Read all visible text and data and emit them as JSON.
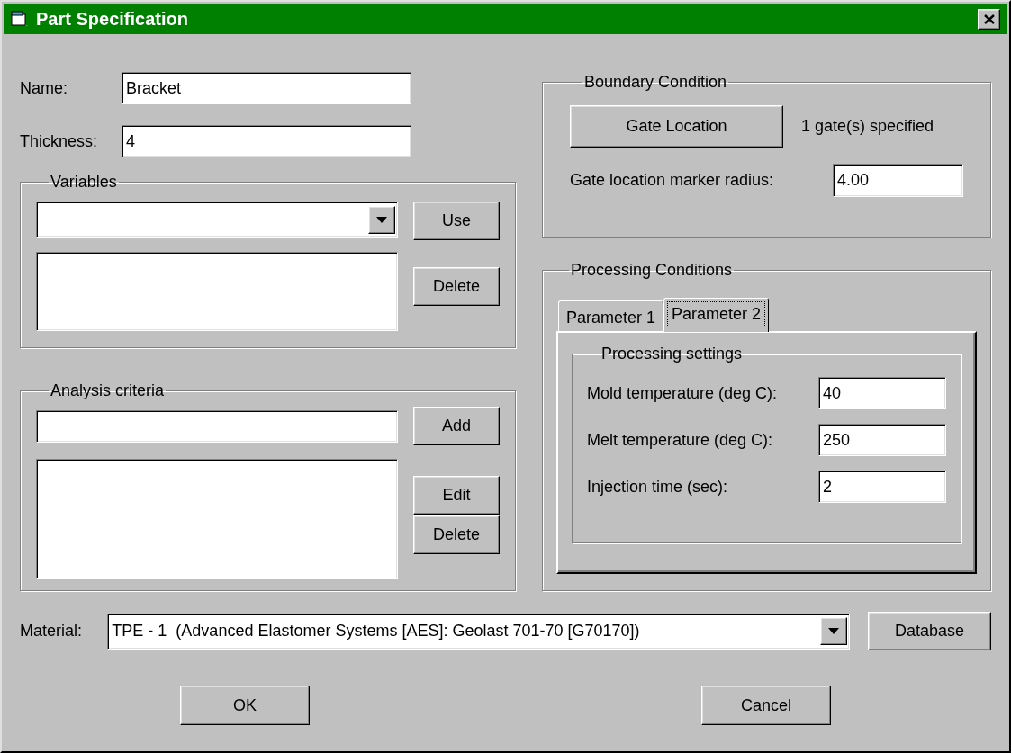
{
  "window": {
    "title": "Part Specification"
  },
  "name": {
    "label": "Name:",
    "value": "Bracket"
  },
  "thickness": {
    "label": "Thickness:",
    "value": "4"
  },
  "variables": {
    "title": "Variables",
    "buttons": [
      "Use",
      "Delete"
    ]
  },
  "analysis_criteria": {
    "title": "Analysis criteria",
    "buttons": [
      "Add",
      "Edit",
      "Delete"
    ]
  },
  "boundary_condition": {
    "title": "Boundary Condition",
    "gate_button": "Gate Location",
    "gate_status": "1 gate(s) specified",
    "radius_label": "Gate location marker radius:",
    "radius_value": "4.00"
  },
  "processing_conditions": {
    "title": "Processing Conditions",
    "tabs": [
      {
        "label": "Parameter 1",
        "selected": false
      },
      {
        "label": "Parameter 2",
        "selected": true
      }
    ],
    "group_title": "Processing settings",
    "fields": [
      {
        "label": "Mold temperature (deg C):",
        "value": "40"
      },
      {
        "label": "Melt temperature (deg C):",
        "value": "250"
      },
      {
        "label": "Injection time (sec):",
        "value": "2"
      }
    ]
  },
  "material": {
    "label": "Material:",
    "value": "TPE - 1  (Advanced Elastomer Systems [AES]: Geolast 701-70 [G70170])",
    "button": "Database"
  },
  "dialog_buttons": [
    "OK",
    "Cancel"
  ]
}
